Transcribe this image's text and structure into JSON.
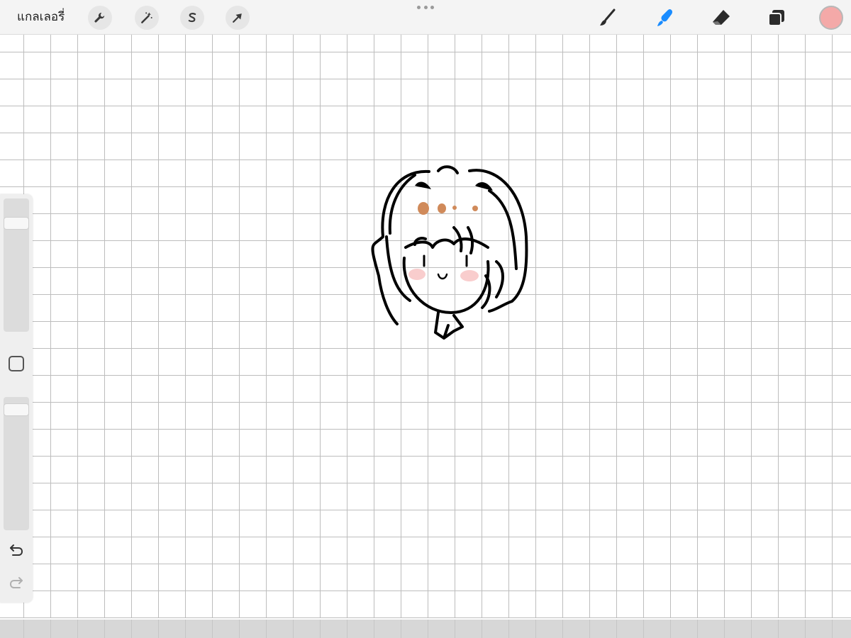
{
  "toolbar": {
    "gallery_label": "แกลเลอรี่",
    "left_tools": [
      {
        "name": "actions",
        "icon": "wrench-icon"
      },
      {
        "name": "adjustments",
        "icon": "magic-wand-icon"
      },
      {
        "name": "selection",
        "icon": "selection-s-icon"
      },
      {
        "name": "transform",
        "icon": "arrow-cursor-icon"
      }
    ],
    "right_tools": [
      {
        "name": "brush",
        "icon": "brush-icon",
        "active": false
      },
      {
        "name": "smudge",
        "icon": "smudge-finger-icon",
        "active": true
      },
      {
        "name": "eraser",
        "icon": "eraser-icon",
        "active": false
      },
      {
        "name": "layers",
        "icon": "layers-icon",
        "active": false
      }
    ],
    "current_color": "#f4a9a8",
    "active_tool_color": "#1a8cff"
  },
  "sidebar": {
    "brush_size_level": 0.15,
    "opacity_level": 0.05,
    "modify_icon": "square-icon",
    "undo_icon": "undo-icon",
    "redo_icon": "redo-icon"
  },
  "canvas": {
    "grid": true,
    "grid_color": "#bdbdbd",
    "stroke_color": "#000000",
    "accent_colors": {
      "freckle": "#d08a5a",
      "blush": "#f7b8b8"
    }
  }
}
